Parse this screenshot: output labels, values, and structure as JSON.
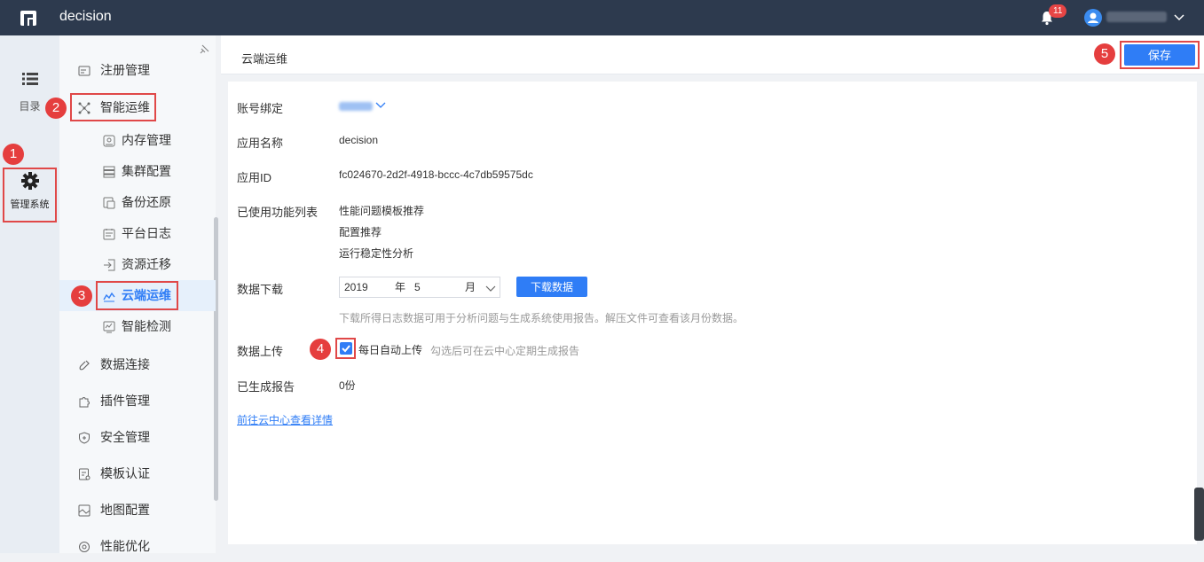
{
  "app": {
    "title": "decision",
    "notification_count": "11"
  },
  "rail": {
    "items": [
      {
        "label": "目录",
        "icon": "list-icon"
      },
      {
        "label": "管理系统",
        "icon": "gear-icon"
      }
    ]
  },
  "sidebar": {
    "items": [
      {
        "label": "注册管理",
        "icon": "register-icon",
        "level": 1
      },
      {
        "label": "智能运维",
        "icon": "ops-icon",
        "level": 1
      },
      {
        "label": "内存管理",
        "icon": "memory-icon",
        "level": 2
      },
      {
        "label": "集群配置",
        "icon": "cluster-icon",
        "level": 2
      },
      {
        "label": "备份还原",
        "icon": "backup-icon",
        "level": 2
      },
      {
        "label": "平台日志",
        "icon": "log-icon",
        "level": 2
      },
      {
        "label": "资源迁移",
        "icon": "migrate-icon",
        "level": 2
      },
      {
        "label": "云端运维",
        "icon": "cloud-chart-icon",
        "level": 2,
        "active": true
      },
      {
        "label": "智能检测",
        "icon": "detect-icon",
        "level": 2
      },
      {
        "label": "数据连接",
        "icon": "link-icon",
        "level": 1
      },
      {
        "label": "插件管理",
        "icon": "puzzle-icon",
        "level": 1
      },
      {
        "label": "安全管理",
        "icon": "shield-icon",
        "level": 1
      },
      {
        "label": "模板认证",
        "icon": "template-icon",
        "level": 1
      },
      {
        "label": "地图配置",
        "icon": "map-icon",
        "level": 1
      },
      {
        "label": "性能优化",
        "icon": "performance-icon",
        "level": 1
      }
    ]
  },
  "steps": [
    "1",
    "2",
    "3",
    "4",
    "5"
  ],
  "page": {
    "title": "云端运维",
    "save_label": "保存",
    "fields": {
      "account_label": "账号绑定",
      "app_name_label": "应用名称",
      "app_name_value": "decision",
      "app_id_label": "应用ID",
      "app_id_value": "fc024670-2d2f-4918-bccc-4c7db59575dc",
      "features_label": "已使用功能列表",
      "features": [
        "性能问题模板推荐",
        "配置推荐",
        "运行稳定性分析"
      ],
      "download_label": "数据下载",
      "year_value": "2019",
      "year_unit": "年",
      "month_value": "5",
      "month_unit": "月",
      "download_button": "下载数据",
      "download_hint": "下载所得日志数据可用于分析问题与生成系统使用报告。解压文件可查看该月份数据。",
      "upload_label": "数据上传",
      "upload_checkbox_label": "每日自动上传",
      "upload_checked": true,
      "upload_hint": "勾选后可在云中心定期生成报告",
      "reports_label": "已生成报告",
      "reports_value": "0份",
      "cloud_link": "前往云中心查看详情"
    }
  },
  "colors": {
    "topbar": "#2d3a4e",
    "accent": "#2f7df6",
    "highlight": "#e04848"
  }
}
